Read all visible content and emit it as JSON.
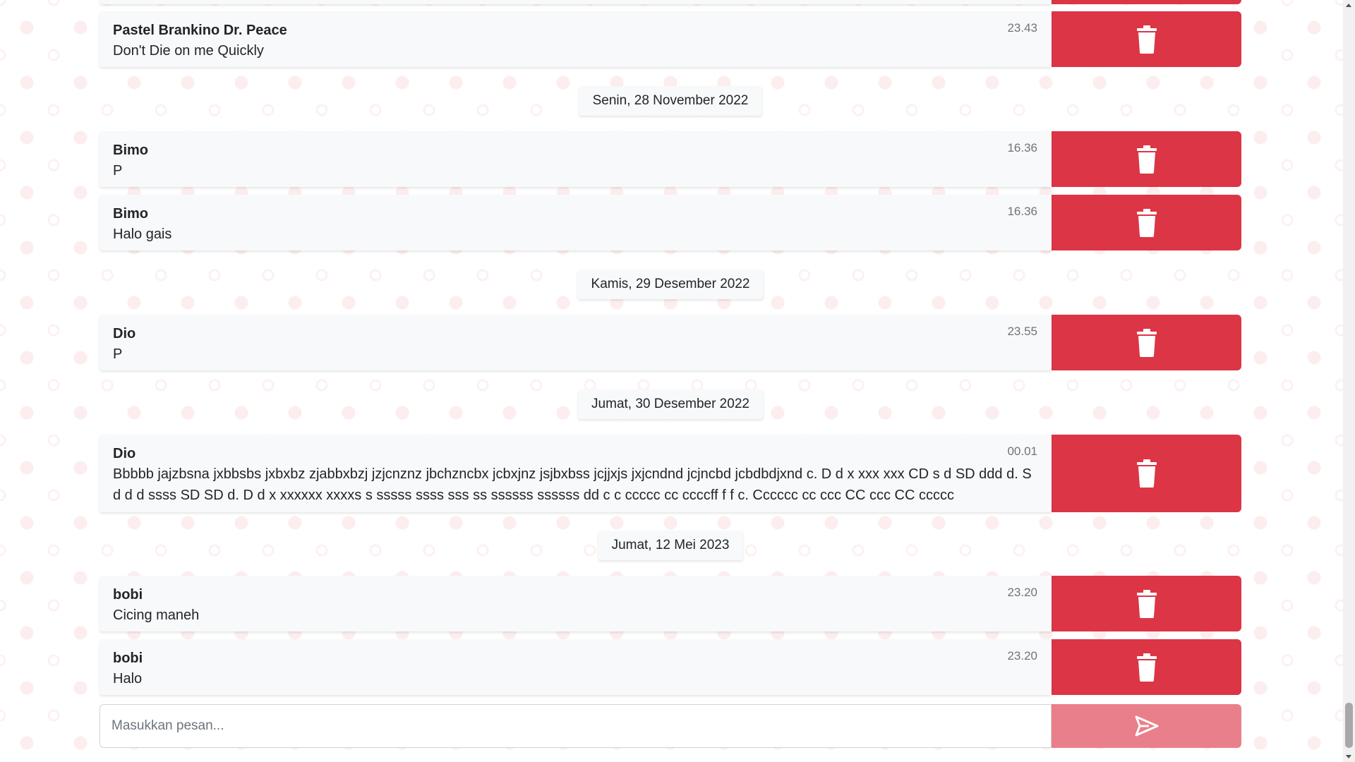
{
  "messages": [
    {
      "sender": "Pastel Brankino Dr. Peace",
      "text": "Don't Die on me Quickly",
      "time": "23.43"
    },
    {
      "sender": "Bimo",
      "text": "P",
      "time": "16.36"
    },
    {
      "sender": "Bimo",
      "text": "Halo gais",
      "time": "16.36"
    },
    {
      "sender": "Dio",
      "text": "P",
      "time": "23.55"
    },
    {
      "sender": "Dio",
      "text": "Bbbbb jajzbsna jxbbsbs jxbxbz zjabbxbzj jzjcnznz jbchzncbx jcbxjnz jsjbxbss jcjjxjs jxjcndnd jcjncbd jcbdbdjxnd c. D d x xxx xxx CD s d SD ddd d. S d d d ssss SD SD d. D d x xxxxxx xxxxs s sssss ssss sss ss ssssss ssssss dd c c ccccc cc ccccff f f c. Cccccc cc ccc CC ccc CC ccccc",
      "time": "00.01"
    },
    {
      "sender": "bobi",
      "text": "Cicing maneh",
      "time": "23.20"
    },
    {
      "sender": "bobi",
      "text": "Halo",
      "time": "23.20"
    }
  ],
  "dates": [
    "Senin, 28 November 2022",
    "Kamis, 29 Desember 2022",
    "Jumat, 30 Desember 2022",
    "Jumat, 12 Mei 2023"
  ],
  "composer": {
    "placeholder": "Masukkan pesan..."
  },
  "icons": {
    "delete": "trash-icon",
    "send": "send-icon"
  },
  "colors": {
    "delete": "#dc3545",
    "send": "#e97f8a",
    "bubble": "#f8f9fa"
  }
}
